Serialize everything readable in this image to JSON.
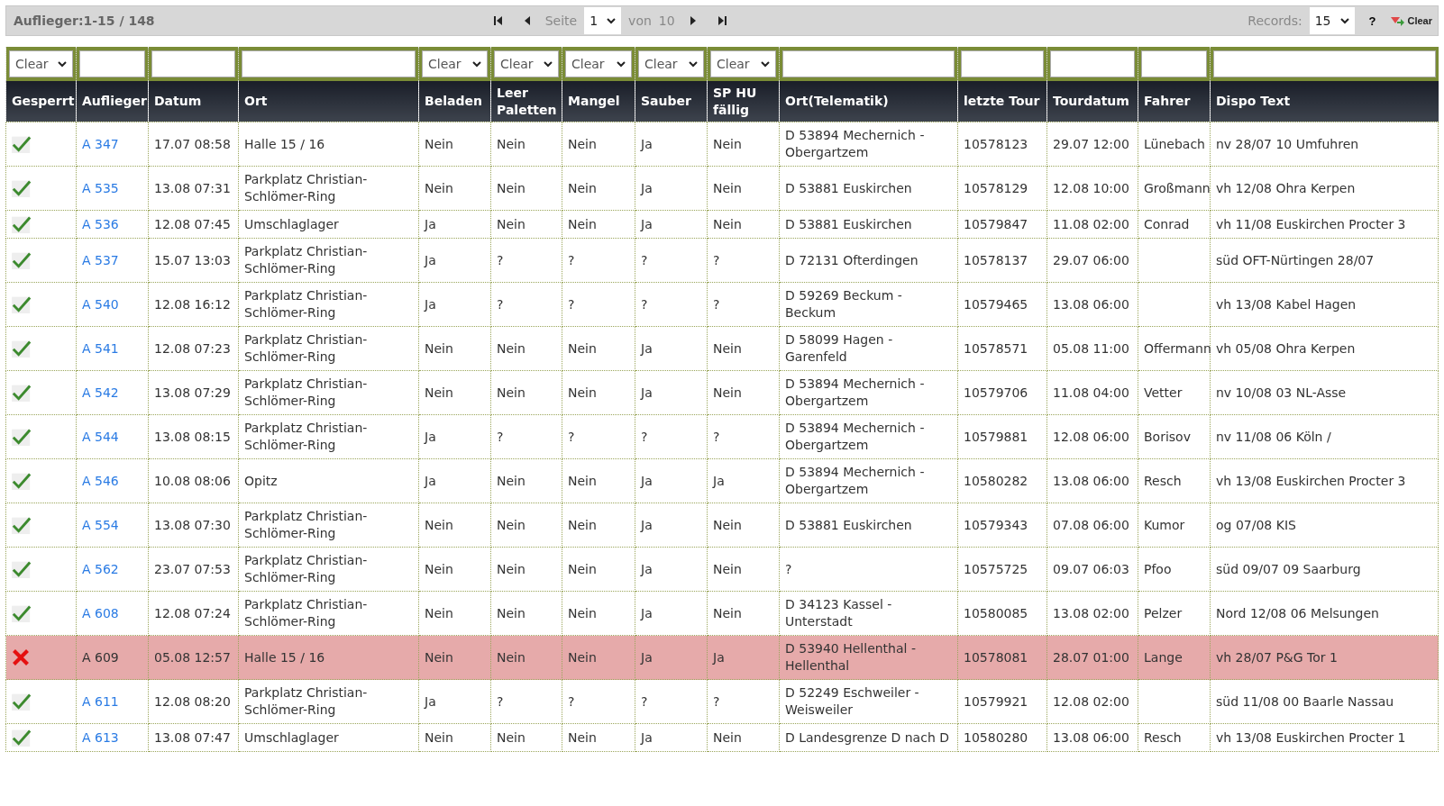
{
  "toolbar": {
    "title": "Auflieger:1-15 / 148",
    "page_label": "Seite",
    "page": "1",
    "of_label": "von",
    "page_count": "10",
    "records_label": "Records:",
    "records": "15",
    "help": "?",
    "clear": "Clear"
  },
  "filters": [
    {
      "kind": "select",
      "value": "Clear"
    },
    {
      "kind": "text"
    },
    {
      "kind": "text"
    },
    {
      "kind": "text"
    },
    {
      "kind": "select",
      "value": "Clear"
    },
    {
      "kind": "select",
      "value": "Clear"
    },
    {
      "kind": "select",
      "value": "Clear"
    },
    {
      "kind": "select",
      "value": "Clear"
    },
    {
      "kind": "select",
      "value": "Clear"
    },
    {
      "kind": "text"
    },
    {
      "kind": "text"
    },
    {
      "kind": "text"
    },
    {
      "kind": "text"
    },
    {
      "kind": "text"
    }
  ],
  "columns": [
    "Gesperrt",
    "Auflieger",
    "Datum",
    "Ort",
    "Beladen",
    "Leer Paletten",
    "Mangel",
    "Sauber",
    "SP HU fällig",
    "Ort(Telematik)",
    "letzte Tour",
    "Tourdatum",
    "Fahrer",
    "Dispo Text"
  ],
  "rows": [
    {
      "locked": false,
      "cells": [
        "A 347",
        "17.07 08:58",
        "Halle 15 / 16",
        "Nein",
        "Nein",
        "Nein",
        "Ja",
        "Nein",
        "D 53894 Mechernich - Obergartzem",
        "10578123",
        "29.07 12:00",
        "Lünebach",
        "nv 28/07 10 Umfuhren"
      ]
    },
    {
      "locked": false,
      "cells": [
        "A 535",
        "13.08 07:31",
        "Parkplatz Christian-Schlömer-Ring",
        "Nein",
        "Nein",
        "Nein",
        "Ja",
        "Nein",
        "D 53881 Euskirchen",
        "10578129",
        "12.08 10:00",
        "Großmann",
        "vh 12/08 Ohra Kerpen"
      ]
    },
    {
      "locked": false,
      "cells": [
        "A 536",
        "12.08 07:45",
        "Umschlaglager",
        "Ja",
        "Nein",
        "Nein",
        "Ja",
        "Nein",
        "D 53881 Euskirchen",
        "10579847",
        "11.08 02:00",
        "Conrad",
        "vh 11/08 Euskirchen Procter 3"
      ]
    },
    {
      "locked": false,
      "cells": [
        "A 537",
        "15.07 13:03",
        "Parkplatz Christian-Schlömer-Ring",
        "Ja",
        "?",
        "?",
        "?",
        "?",
        "D 72131 Ofterdingen",
        "10578137",
        "29.07 06:00",
        "",
        "süd OFT-Nürtingen 28/07"
      ]
    },
    {
      "locked": false,
      "cells": [
        "A 540",
        "12.08 16:12",
        "Parkplatz Christian-Schlömer-Ring",
        "Ja",
        "?",
        "?",
        "?",
        "?",
        "D 59269 Beckum - Beckum",
        "10579465",
        "13.08 06:00",
        "",
        "vh 13/08 Kabel Hagen"
      ]
    },
    {
      "locked": false,
      "cells": [
        "A 541",
        "12.08 07:23",
        "Parkplatz Christian-Schlömer-Ring",
        "Nein",
        "Nein",
        "Nein",
        "Ja",
        "Nein",
        "D 58099 Hagen - Garenfeld",
        "10578571",
        "05.08 11:00",
        "Offermann",
        "vh 05/08 Ohra Kerpen"
      ]
    },
    {
      "locked": false,
      "cells": [
        "A 542",
        "13.08 07:29",
        "Parkplatz Christian-Schlömer-Ring",
        "Nein",
        "Nein",
        "Nein",
        "Ja",
        "Nein",
        "D 53894 Mechernich - Obergartzem",
        "10579706",
        "11.08 04:00",
        "Vetter",
        "nv 10/08 03 NL-Asse"
      ]
    },
    {
      "locked": false,
      "cells": [
        "A 544",
        "13.08 08:15",
        "Parkplatz Christian-Schlömer-Ring",
        "Ja",
        "?",
        "?",
        "?",
        "?",
        "D 53894 Mechernich - Obergartzem",
        "10579881",
        "12.08 06:00",
        "Borisov",
        "nv 11/08 06 Köln /"
      ]
    },
    {
      "locked": false,
      "cells": [
        "A 546",
        "10.08 08:06",
        "Opitz",
        "Ja",
        "Nein",
        "Nein",
        "Ja",
        "Ja",
        "D 53894 Mechernich - Obergartzem",
        "10580282",
        "13.08 06:00",
        "Resch",
        "vh 13/08 Euskirchen Procter 3"
      ]
    },
    {
      "locked": false,
      "cells": [
        "A 554",
        "13.08 07:30",
        "Parkplatz Christian-Schlömer-Ring",
        "Nein",
        "Nein",
        "Nein",
        "Ja",
        "Nein",
        "D 53881 Euskirchen",
        "10579343",
        "07.08 06:00",
        "Kumor",
        "og 07/08 KIS"
      ]
    },
    {
      "locked": false,
      "cells": [
        "A 562",
        "23.07 07:53",
        "Parkplatz Christian-Schlömer-Ring",
        "Nein",
        "Nein",
        "Nein",
        "Ja",
        "Nein",
        "?",
        "10575725",
        "09.07 06:03",
        "Pfoo",
        "süd 09/07 09 Saarburg"
      ]
    },
    {
      "locked": false,
      "cells": [
        "A 608",
        "12.08 07:24",
        "Parkplatz Christian-Schlömer-Ring",
        "Nein",
        "Nein",
        "Nein",
        "Ja",
        "Nein",
        "D 34123 Kassel - Unterstadt",
        "10580085",
        "13.08 02:00",
        "Pelzer",
        "Nord 12/08 06 Melsungen"
      ]
    },
    {
      "locked": true,
      "cells": [
        "A 609",
        "05.08 12:57",
        "Halle 15 / 16",
        "Nein",
        "Nein",
        "Nein",
        "Ja",
        "Ja",
        "D 53940 Hellenthal - Hellenthal",
        "10578081",
        "28.07 01:00",
        "Lange",
        "vh 28/07 P&G Tor 1"
      ]
    },
    {
      "locked": false,
      "cells": [
        "A 611",
        "12.08 08:20",
        "Parkplatz Christian-Schlömer-Ring",
        "Ja",
        "?",
        "?",
        "?",
        "?",
        "D 52249 Eschweiler - Weisweiler",
        "10579921",
        "12.08 02:00",
        "",
        "süd 11/08 00 Baarle Nassau"
      ]
    },
    {
      "locked": false,
      "cells": [
        "A 613",
        "13.08 07:47",
        "Umschlaglager",
        "Nein",
        "Nein",
        "Nein",
        "Ja",
        "Nein",
        "D Landesgrenze D nach D",
        "10580280",
        "13.08 06:00",
        "Resch",
        "vh 13/08 Euskirchen Procter 1"
      ]
    }
  ]
}
